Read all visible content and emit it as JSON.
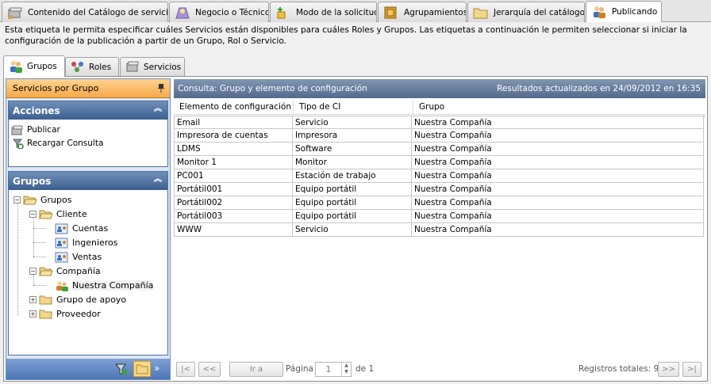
{
  "top_tabs": [
    {
      "label": "Contenido del Catálogo de servicios",
      "icon": "catalog-icon"
    },
    {
      "label": "Negocio o Técnico",
      "icon": "business-icon"
    },
    {
      "label": "Modo de la solicitud",
      "icon": "request-mode-icon"
    },
    {
      "label": "Agrupamientos",
      "icon": "grouping-icon"
    },
    {
      "label": "Jerarquía del catálogo",
      "icon": "folder-icon"
    },
    {
      "label": "Publicando",
      "icon": "users-icon"
    }
  ],
  "description": "Esta etiqueta le permita especificar cuáles Servicios están disponibles para cuáles Roles y Grupos. Las etiquetas a continuación le permiten seleccionar si iniciar la configuración de la publicación a partir de un Grupo, Rol o Servicio.",
  "sub_tabs": [
    {
      "label": "Grupos",
      "icon": "users-icon"
    },
    {
      "label": "Roles",
      "icon": "roles-icon"
    },
    {
      "label": "Servicios",
      "icon": "services-icon"
    }
  ],
  "left_pane": {
    "title": "Servicios por Grupo",
    "actions": {
      "header": "Acciones",
      "items": [
        {
          "label": "Publicar",
          "icon": "publish-icon"
        },
        {
          "label": "Recargar Consulta",
          "icon": "reload-icon"
        }
      ]
    },
    "groups": {
      "header": "Grupos",
      "tree": [
        {
          "label": "Grupos",
          "level": 0,
          "expander": "−",
          "icon": "open-folder-icon"
        },
        {
          "label": "Cliente",
          "level": 1,
          "expander": "−",
          "icon": "open-folder-icon"
        },
        {
          "label": "Cuentas",
          "level": 2,
          "expander": "",
          "icon": "group-card-icon"
        },
        {
          "label": "Ingenieros",
          "level": 2,
          "expander": "",
          "icon": "group-card-icon"
        },
        {
          "label": "Ventas",
          "level": 2,
          "expander": "",
          "icon": "group-card-icon"
        },
        {
          "label": "Compañía",
          "level": 1,
          "expander": "−",
          "icon": "open-folder-icon"
        },
        {
          "label": "Nuestra Compañía",
          "level": 2,
          "expander": "",
          "icon": "company-users-icon"
        },
        {
          "label": "Grupo de apoyo",
          "level": 1,
          "expander": "+",
          "icon": "folder-icon"
        },
        {
          "label": "Proveedor",
          "level": 1,
          "expander": "+",
          "icon": "folder-icon"
        }
      ]
    },
    "footer_icons": [
      "filter-icon",
      "folder-icon",
      "expand-more-icon"
    ]
  },
  "main": {
    "header_left": "Consulta: Grupo y elemento de configuración",
    "header_right": "Resultados actualizados en 24/09/2012 en 16:35",
    "columns": [
      "Elemento de configuración",
      "Tipo de CI",
      "Grupo"
    ],
    "rows": [
      [
        "Email",
        "Servicio",
        "Nuestra Compañía"
      ],
      [
        "Impresora de cuentas",
        "Impresora",
        "Nuestra Compañía"
      ],
      [
        "LDMS",
        "Software",
        "Nuestra Compañía"
      ],
      [
        "Monitor 1",
        "Monitor",
        "Nuestra Compañía"
      ],
      [
        "PC001",
        "Estación de trabajo",
        "Nuestra Compañía"
      ],
      [
        "Portátil001",
        "Equipo portátil",
        "Nuestra Compañía"
      ],
      [
        "Portátil002",
        "Equipo portátil",
        "Nuestra Compañía"
      ],
      [
        "Portátil003",
        "Equipo portátil",
        "Nuestra Compañía"
      ],
      [
        "WWW",
        "Servicio",
        "Nuestra Compañía"
      ]
    ]
  },
  "pager": {
    "first": "|<",
    "prev": "<<",
    "goto": "Ir a",
    "page_label": "Página",
    "page_value": "1",
    "of_label": "de 1",
    "total_label": "Registros totales: 9",
    "next": ">>",
    "last": ">|"
  }
}
